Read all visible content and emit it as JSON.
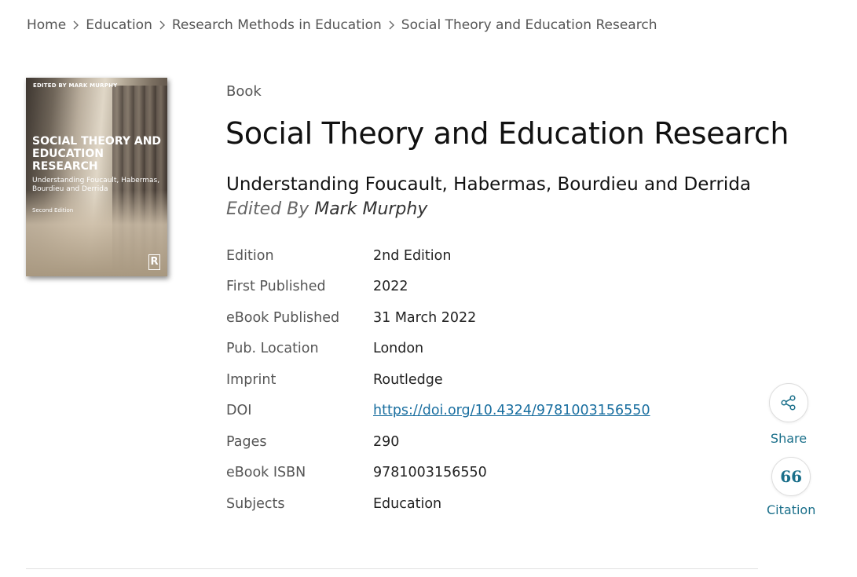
{
  "breadcrumb": [
    "Home",
    "Education",
    "Research Methods in Education",
    "Social Theory and Education Research"
  ],
  "cover": {
    "edited_by": "EDITED BY MARK MURPHY",
    "title": "SOCIAL THEORY AND EDUCATION RESEARCH",
    "subtitle": "Understanding Foucault, Habermas, Bourdieu and Derrida",
    "edition": "Second Edition",
    "publisher_logo": "R"
  },
  "book": {
    "type": "Book",
    "title": "Social Theory and Education Research",
    "subtitle": "Understanding Foucault, Habermas, Bourdieu and Derrida",
    "editors_prefix": "Edited By",
    "editors": "Mark Murphy"
  },
  "metadata": [
    {
      "label": "Edition",
      "value": "2nd Edition"
    },
    {
      "label": "First Published",
      "value": "2022"
    },
    {
      "label": "eBook Published",
      "value": "31 March 2022"
    },
    {
      "label": "Pub. Location",
      "value": "London"
    },
    {
      "label": "Imprint",
      "value": "Routledge"
    },
    {
      "label": "DOI",
      "value": "https://doi.org/10.4324/9781003156550"
    },
    {
      "label": "Pages",
      "value": "290"
    },
    {
      "label": "eBook ISBN",
      "value": "9781003156550"
    },
    {
      "label": "Subjects",
      "value": "Education"
    }
  ],
  "actions": {
    "share": {
      "label": "Share",
      "icon": "share-icon"
    },
    "citation": {
      "label": "Citation",
      "icon": "quote-icon",
      "glyph": "66"
    }
  },
  "colors": {
    "link": "#1a6fa0",
    "accent": "#1a6f8a"
  }
}
